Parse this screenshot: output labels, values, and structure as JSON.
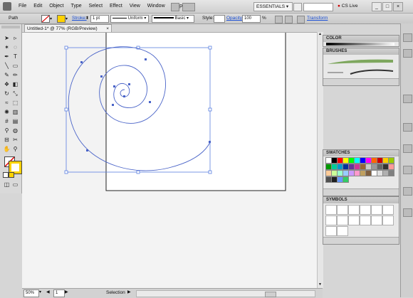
{
  "menu": {
    "items": [
      "File",
      "Edit",
      "Object",
      "Type",
      "Select",
      "Effect",
      "View",
      "Window",
      "Help"
    ],
    "workspace": "ESSENTIALS",
    "cs_live": "CS Live",
    "window_controls": [
      "_",
      "□",
      "×"
    ]
  },
  "control_bar": {
    "selection_label": "Path",
    "stroke_label": "Stroke:",
    "stroke_value": "1 pt",
    "profile": "Uniform",
    "brush": "Basic",
    "style_label": "Style:",
    "opacity_label": "Opacity:",
    "opacity_value": "100",
    "percent": "%",
    "transform_link": "Transform",
    "fill_color": "#ffffff",
    "stroke_color": "#ffd200"
  },
  "document": {
    "tab_title": "Untitled-1* @ 77% (RGB/Preview)",
    "close_glyph": "×"
  },
  "status": {
    "zoom": "50%",
    "page": "1",
    "tool": "Selection"
  },
  "panels": {
    "color": "COLOR",
    "brushes": "BRUSHES",
    "swatches": "SWATCHES",
    "symbols": "SYMBOLS"
  },
  "colors": {
    "path_stroke": "#4a64c8",
    "selection": "#5a7fe0",
    "artboard_border": "#222222",
    "link_blue": "#1a4fd6"
  },
  "icons": [
    "selection-tool-icon",
    "direct-selection-tool-icon",
    "magic-wand-icon",
    "lasso-icon",
    "pen-icon",
    "type-icon",
    "line-icon",
    "rectangle-icon",
    "paintbrush-icon",
    "pencil-icon",
    "blob-brush-icon",
    "eraser-icon",
    "rotate-icon",
    "scale-icon",
    "warp-icon",
    "free-transform-icon",
    "symbol-sprayer-icon",
    "graph-icon",
    "mesh-icon",
    "gradient-icon",
    "eyedropper-icon",
    "blend-icon",
    "slice-icon",
    "scissors-icon",
    "hand-icon",
    "zoom-icon"
  ]
}
